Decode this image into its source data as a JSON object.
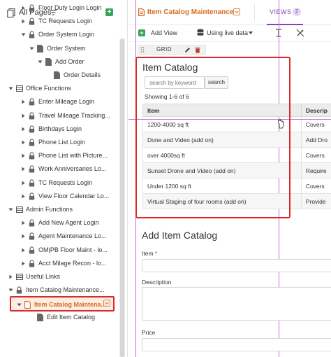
{
  "sidebar": {
    "title": "All Pages",
    "items": [
      {
        "label": "Floor Duty Login Login",
        "level": 2,
        "type": "page-lock",
        "caret": "right"
      },
      {
        "label": "TC Requests Login",
        "level": 2,
        "type": "page-lock",
        "caret": "right"
      },
      {
        "label": "Order System Login",
        "level": 2,
        "type": "page-lock",
        "caret": "down"
      },
      {
        "label": "Order System",
        "level": 3,
        "type": "page",
        "caret": "down"
      },
      {
        "label": "Add Order",
        "level": 4,
        "type": "page",
        "caret": "down"
      },
      {
        "label": "Order Details",
        "level": 5,
        "type": "page",
        "caret": "none"
      },
      {
        "label": "Office Functions",
        "level": 1,
        "type": "folder",
        "caret": "down"
      },
      {
        "label": "Enter Mileage Login",
        "level": 2,
        "type": "page-lock",
        "caret": "right"
      },
      {
        "label": "Travel Mileage Tracking...",
        "level": 2,
        "type": "page-lock",
        "caret": "right"
      },
      {
        "label": "Birthdays Login",
        "level": 2,
        "type": "page-lock",
        "caret": "right"
      },
      {
        "label": "Phone List Login",
        "level": 2,
        "type": "page-lock",
        "caret": "right"
      },
      {
        "label": "Phone List with Picture...",
        "level": 2,
        "type": "page-lock",
        "caret": "right"
      },
      {
        "label": "Work Anniversaries Lo...",
        "level": 2,
        "type": "page-lock",
        "caret": "right"
      },
      {
        "label": "TC Requests Login",
        "level": 2,
        "type": "page-lock",
        "caret": "right"
      },
      {
        "label": "View Floor Calendar Lo...",
        "level": 2,
        "type": "page-lock",
        "caret": "right"
      },
      {
        "label": "Admin Functions",
        "level": 1,
        "type": "folder",
        "caret": "down"
      },
      {
        "label": "Add New Agent Login",
        "level": 2,
        "type": "page-lock",
        "caret": "right"
      },
      {
        "label": "Agent Maintenance Lo...",
        "level": 2,
        "type": "page-lock",
        "caret": "right"
      },
      {
        "label": "OM|PB Floor Maint - lo...",
        "level": 2,
        "type": "page-lock",
        "caret": "right"
      },
      {
        "label": "Acct Milage Recon - lo...",
        "level": 2,
        "type": "page-lock",
        "caret": "right"
      },
      {
        "label": "Useful Links",
        "level": 1,
        "type": "folder",
        "caret": "right"
      },
      {
        "label": "Item Catalog Maintenance...",
        "level": 1,
        "type": "page-lock",
        "caret": "down"
      },
      {
        "label": "Item Catalog Maintena...",
        "level": 2,
        "type": "page",
        "caret": "down",
        "selected": true
      },
      {
        "label": "Edit Item Catalog",
        "level": 3,
        "type": "page",
        "caret": "none"
      }
    ]
  },
  "header": {
    "page_title": "Item Catalog Maintenance",
    "views_label": "VIEWS",
    "views_count": "2"
  },
  "toolbar": {
    "add_view": "Add View",
    "data_source": "Using live data"
  },
  "grid_label": "GRID",
  "catalog": {
    "title": "Item Catalog",
    "search_placeholder": "search by keyword",
    "search_button": "search",
    "showing": "Showing 1-6 of 6",
    "columns": [
      "Item",
      "Descrip"
    ],
    "rows": [
      [
        "1200-4000 sq ft",
        "Covers"
      ],
      [
        "Done and Video (add on)",
        "Add Dro"
      ],
      [
        "over 4000sq ft",
        "Covers"
      ],
      [
        "Sunset Drone and Video (add on)",
        "Require"
      ],
      [
        "Under 1200 sq ft",
        "Covers"
      ],
      [
        "Virtual Staging of four rooms (add on)",
        "Provide"
      ]
    ]
  },
  "form": {
    "title": "Add Item Catalog",
    "item_label": "Item",
    "required_mark": "*",
    "description_label": "Description",
    "price_label": "Price"
  },
  "colors": {
    "accent_orange": "#d86b1e",
    "views_purple": "#8e3cb8",
    "highlight_red": "#d9292a",
    "add_green": "#3aa55a"
  }
}
